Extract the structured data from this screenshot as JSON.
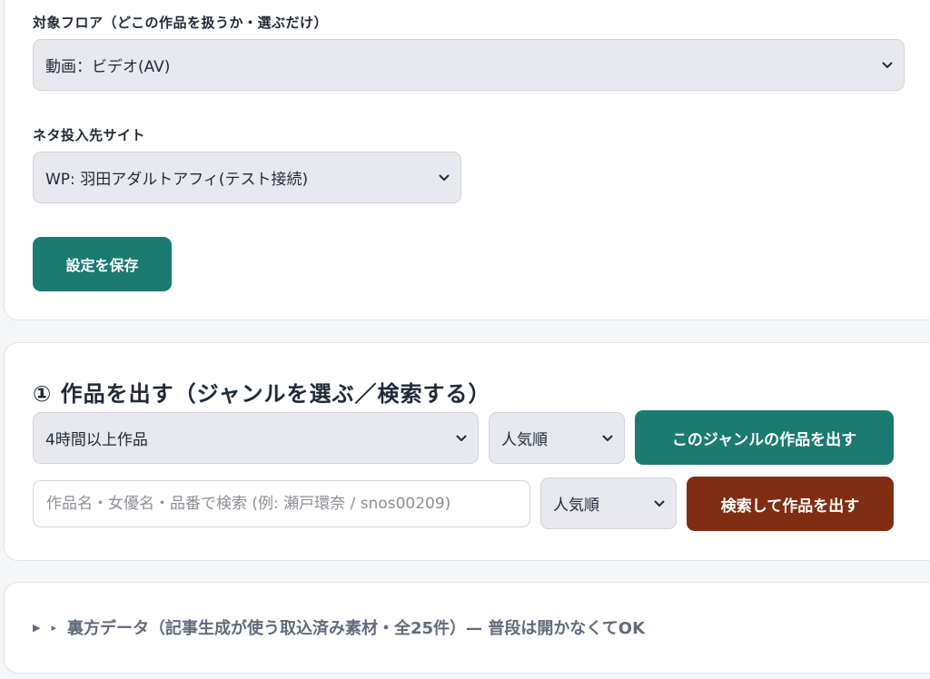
{
  "settings": {
    "floor_label": "対象フロア（どこの作品を扱うか・選ぶだけ）",
    "floor_value": "動画：ビデオ(AV)",
    "site_label": "ネタ投入先サイト",
    "site_value": "WP: 羽田アダルトアフィ(テスト接続)",
    "save_label": "設定を保存"
  },
  "works": {
    "title": "① 作品を出す（ジャンルを選ぶ／検索する）",
    "genre_value": "4時間以上作品",
    "genre_sort_value": "人気順",
    "genre_button_label": "このジャンルの作品を出す",
    "search_placeholder": "作品名・女優名・品番で検索 (例: 瀬戸環奈 / snos00209)",
    "search_sort_value": "人気順",
    "search_button_label": "検索して作品を出す"
  },
  "backend": {
    "summary_text": "裏方データ（記事生成が使う取込済み素材・全25件）— 普段は開かなくてOK"
  },
  "colors": {
    "teal": "#1b7b70",
    "rust": "#7f2d13",
    "select_bg": "#e8e9ee"
  },
  "icons": {
    "dropdown": "chevron-down-icon",
    "disclosure": "triangle-right-icon"
  }
}
